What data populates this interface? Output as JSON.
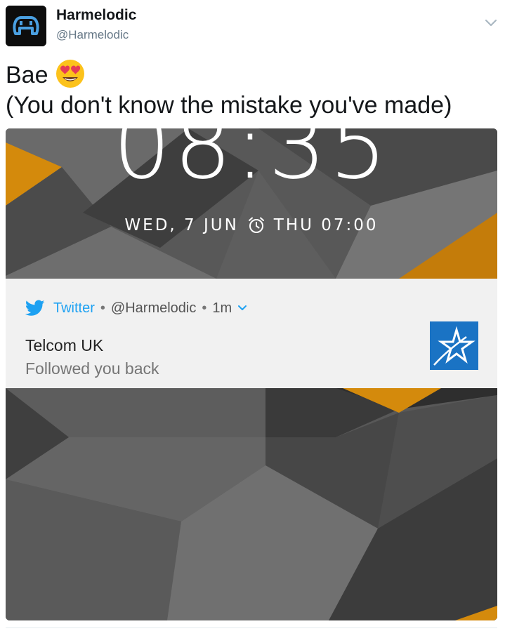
{
  "tweet": {
    "display_name": "Harmelodic",
    "handle": "@Harmelodic",
    "avatar_icon": "harmelodic-logo-icon",
    "text_line1": "Bae",
    "emoji": "heart-eyes-emoji",
    "text_line2": "(You don't know the mistake you've made)",
    "menu_icon": "chevron-down-icon"
  },
  "lockscreen": {
    "time": "08:35",
    "date": "WED, 7 JUN",
    "alarm_icon": "alarm-clock-icon",
    "alarm": "THU 07:00",
    "notification": {
      "app_icon": "twitter-bird-icon",
      "app_name": "Twitter",
      "account": "@Harmelodic",
      "age": "1m",
      "separator": "•",
      "title": "Telcom UK",
      "body": "Followed you back",
      "thumbnail_icon": "telcom-star-logo-icon",
      "accent_color": "#1da1f2"
    }
  },
  "colors": {
    "name_text": "#14171a",
    "handle_text": "#657786",
    "wallpaper_dark": "#3a3a3a",
    "wallpaper_orange": "#d48a0c"
  }
}
